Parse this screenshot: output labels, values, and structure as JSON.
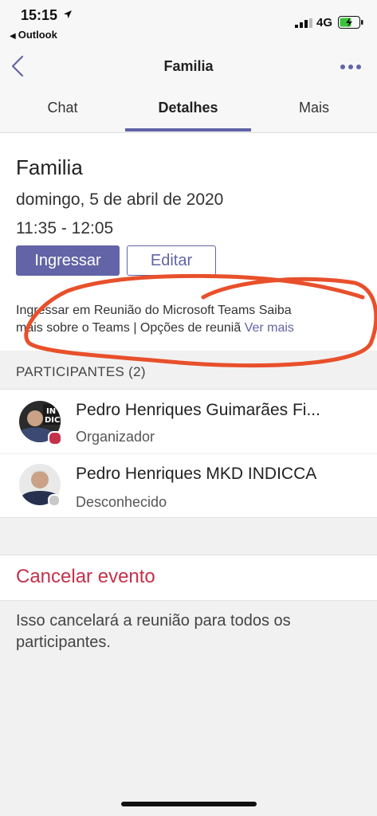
{
  "status_bar": {
    "time": "15:15",
    "back_app": "Outlook",
    "network": "4G"
  },
  "nav": {
    "title": "Familia"
  },
  "tabs": [
    {
      "label": "Chat"
    },
    {
      "label": "Detalhes"
    },
    {
      "label": "Mais"
    }
  ],
  "event": {
    "title": "Familia",
    "date": "domingo, 5 de abril de 2020",
    "time": "11:35 - 12:05",
    "join_label": "Ingressar",
    "edit_label": "Editar",
    "description_line1": "Ingressar em Reunião do Microsoft Teams Saiba",
    "description_line2": "mais sobre o Teams | Opções de reuniã",
    "see_more": "Ver mais"
  },
  "participants": {
    "header": "PARTICIPANTES (2)",
    "items": [
      {
        "name": "Pedro Henriques Guimarães Fi...",
        "role": "Organizador",
        "presence": "busy"
      },
      {
        "name": "Pedro Henriques MKD INDICCA",
        "role": "Desconhecido",
        "presence": "unknown"
      }
    ]
  },
  "cancel": {
    "label": "Cancelar evento",
    "note": "Isso cancelará a reunião para todos os participantes."
  },
  "colors": {
    "accent": "#6264a7",
    "danger": "#c4314b",
    "annotation": "#e8502b"
  },
  "icons": [
    "location-arrow-icon",
    "signal-icon",
    "battery-charging-icon",
    "chevron-left-icon",
    "more-dots-icon"
  ]
}
